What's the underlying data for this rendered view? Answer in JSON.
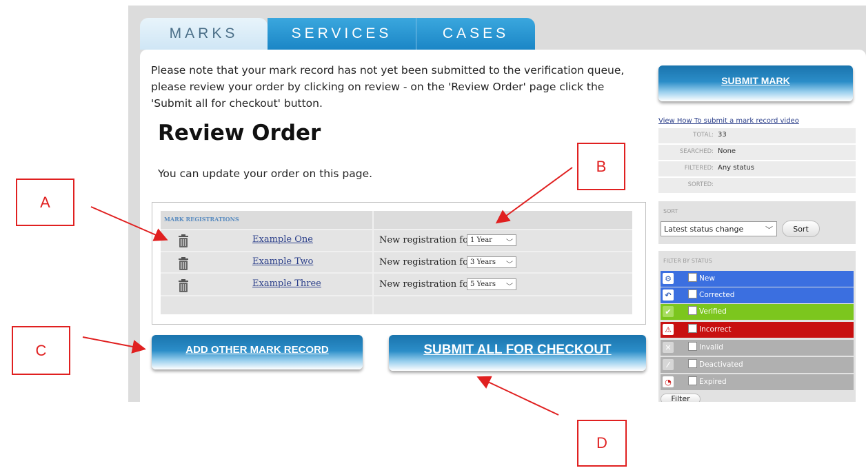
{
  "tabs": [
    {
      "label": "MARKS",
      "active": true
    },
    {
      "label": "SERVICES",
      "active": false
    },
    {
      "label": "CASES",
      "active": false
    }
  ],
  "notice": "Please note that your mark record has not yet been submitted to the verification queue, please review your order by clicking on review - on the 'Review Order' page click the 'Submit all for checkout' button.",
  "page_title": "Review Order",
  "update_text": "You can update your order on this page.",
  "mark_table": {
    "header": "MARK REGISTRATIONS",
    "rows": [
      {
        "name": "Example One",
        "reg_text": "New registration for",
        "period": "1 Year"
      },
      {
        "name": "Example Two",
        "reg_text": "New registration for",
        "period": "3 Years"
      },
      {
        "name": "Example Three",
        "reg_text": "New registration for",
        "period": "5 Years"
      }
    ]
  },
  "buttons": {
    "add_other": "ADD OTHER MARK RECORD",
    "submit_all": "SUBMIT ALL FOR CHECKOUT",
    "submit_mark": "SUBMIT MARK"
  },
  "sidebar": {
    "video_link": "View How To submit a mark record video",
    "stats": [
      {
        "label": "TOTAL:",
        "value": "33"
      },
      {
        "label": "SEARCHED:",
        "value": "None"
      },
      {
        "label": "FILTERED:",
        "value": "Any status"
      },
      {
        "label": "SORTED:",
        "value": ""
      }
    ],
    "sort_label": "SORT",
    "sort_value": "Latest status change",
    "sort_button": "Sort",
    "filter_label": "FILTER BY STATUS",
    "statuses": [
      {
        "label": "New",
        "color": "#3b6fe0",
        "icon": "gear-icon"
      },
      {
        "label": "Corrected",
        "color": "#3b6fe0",
        "icon": "undo-icon"
      },
      {
        "label": "Verified",
        "color": "#7cc61e",
        "icon": "check-icon"
      },
      {
        "label": "Incorrect",
        "color": "#c81010",
        "icon": "warning-icon"
      },
      {
        "label": "Invalid",
        "color": "#b0b0b0",
        "icon": "x-icon"
      },
      {
        "label": "Deactivated",
        "color": "#b0b0b0",
        "icon": "slash-icon"
      },
      {
        "label": "Expired",
        "color": "#b0b0b0",
        "icon": "clock-icon"
      }
    ],
    "filter_button": "Filter"
  },
  "annotations": [
    "A",
    "B",
    "C",
    "D"
  ],
  "colors": {
    "tab_blue": "#1b86c6",
    "annotation_red": "#e02020"
  }
}
